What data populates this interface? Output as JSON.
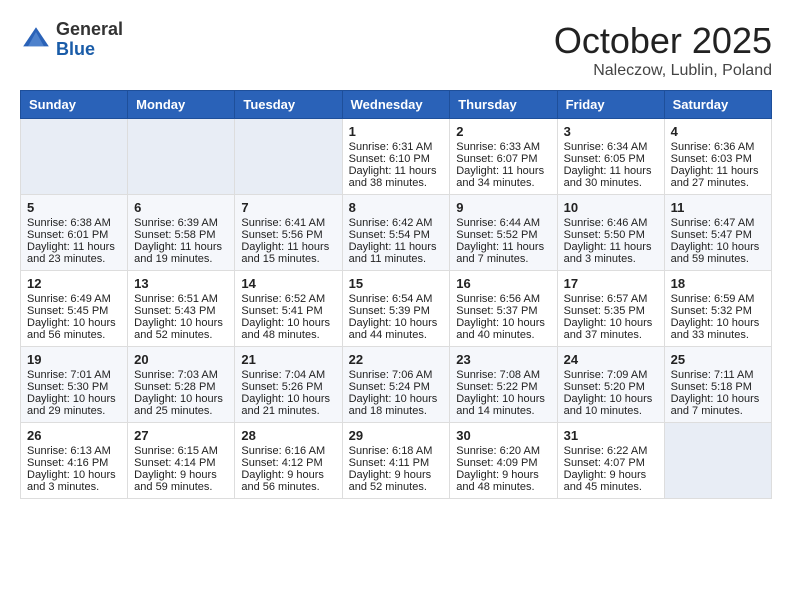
{
  "header": {
    "logo_general": "General",
    "logo_blue": "Blue",
    "month_title": "October 2025",
    "location": "Naleczow, Lublin, Poland"
  },
  "days_of_week": [
    "Sunday",
    "Monday",
    "Tuesday",
    "Wednesday",
    "Thursday",
    "Friday",
    "Saturday"
  ],
  "weeks": [
    [
      {
        "day": "",
        "info": ""
      },
      {
        "day": "",
        "info": ""
      },
      {
        "day": "",
        "info": ""
      },
      {
        "day": "1",
        "info": "Sunrise: 6:31 AM\nSunset: 6:10 PM\nDaylight: 11 hours\nand 38 minutes."
      },
      {
        "day": "2",
        "info": "Sunrise: 6:33 AM\nSunset: 6:07 PM\nDaylight: 11 hours\nand 34 minutes."
      },
      {
        "day": "3",
        "info": "Sunrise: 6:34 AM\nSunset: 6:05 PM\nDaylight: 11 hours\nand 30 minutes."
      },
      {
        "day": "4",
        "info": "Sunrise: 6:36 AM\nSunset: 6:03 PM\nDaylight: 11 hours\nand 27 minutes."
      }
    ],
    [
      {
        "day": "5",
        "info": "Sunrise: 6:38 AM\nSunset: 6:01 PM\nDaylight: 11 hours\nand 23 minutes."
      },
      {
        "day": "6",
        "info": "Sunrise: 6:39 AM\nSunset: 5:58 PM\nDaylight: 11 hours\nand 19 minutes."
      },
      {
        "day": "7",
        "info": "Sunrise: 6:41 AM\nSunset: 5:56 PM\nDaylight: 11 hours\nand 15 minutes."
      },
      {
        "day": "8",
        "info": "Sunrise: 6:42 AM\nSunset: 5:54 PM\nDaylight: 11 hours\nand 11 minutes."
      },
      {
        "day": "9",
        "info": "Sunrise: 6:44 AM\nSunset: 5:52 PM\nDaylight: 11 hours\nand 7 minutes."
      },
      {
        "day": "10",
        "info": "Sunrise: 6:46 AM\nSunset: 5:50 PM\nDaylight: 11 hours\nand 3 minutes."
      },
      {
        "day": "11",
        "info": "Sunrise: 6:47 AM\nSunset: 5:47 PM\nDaylight: 10 hours\nand 59 minutes."
      }
    ],
    [
      {
        "day": "12",
        "info": "Sunrise: 6:49 AM\nSunset: 5:45 PM\nDaylight: 10 hours\nand 56 minutes."
      },
      {
        "day": "13",
        "info": "Sunrise: 6:51 AM\nSunset: 5:43 PM\nDaylight: 10 hours\nand 52 minutes."
      },
      {
        "day": "14",
        "info": "Sunrise: 6:52 AM\nSunset: 5:41 PM\nDaylight: 10 hours\nand 48 minutes."
      },
      {
        "day": "15",
        "info": "Sunrise: 6:54 AM\nSunset: 5:39 PM\nDaylight: 10 hours\nand 44 minutes."
      },
      {
        "day": "16",
        "info": "Sunrise: 6:56 AM\nSunset: 5:37 PM\nDaylight: 10 hours\nand 40 minutes."
      },
      {
        "day": "17",
        "info": "Sunrise: 6:57 AM\nSunset: 5:35 PM\nDaylight: 10 hours\nand 37 minutes."
      },
      {
        "day": "18",
        "info": "Sunrise: 6:59 AM\nSunset: 5:32 PM\nDaylight: 10 hours\nand 33 minutes."
      }
    ],
    [
      {
        "day": "19",
        "info": "Sunrise: 7:01 AM\nSunset: 5:30 PM\nDaylight: 10 hours\nand 29 minutes."
      },
      {
        "day": "20",
        "info": "Sunrise: 7:03 AM\nSunset: 5:28 PM\nDaylight: 10 hours\nand 25 minutes."
      },
      {
        "day": "21",
        "info": "Sunrise: 7:04 AM\nSunset: 5:26 PM\nDaylight: 10 hours\nand 21 minutes."
      },
      {
        "day": "22",
        "info": "Sunrise: 7:06 AM\nSunset: 5:24 PM\nDaylight: 10 hours\nand 18 minutes."
      },
      {
        "day": "23",
        "info": "Sunrise: 7:08 AM\nSunset: 5:22 PM\nDaylight: 10 hours\nand 14 minutes."
      },
      {
        "day": "24",
        "info": "Sunrise: 7:09 AM\nSunset: 5:20 PM\nDaylight: 10 hours\nand 10 minutes."
      },
      {
        "day": "25",
        "info": "Sunrise: 7:11 AM\nSunset: 5:18 PM\nDaylight: 10 hours\nand 7 minutes."
      }
    ],
    [
      {
        "day": "26",
        "info": "Sunrise: 6:13 AM\nSunset: 4:16 PM\nDaylight: 10 hours\nand 3 minutes."
      },
      {
        "day": "27",
        "info": "Sunrise: 6:15 AM\nSunset: 4:14 PM\nDaylight: 9 hours\nand 59 minutes."
      },
      {
        "day": "28",
        "info": "Sunrise: 6:16 AM\nSunset: 4:12 PM\nDaylight: 9 hours\nand 56 minutes."
      },
      {
        "day": "29",
        "info": "Sunrise: 6:18 AM\nSunset: 4:11 PM\nDaylight: 9 hours\nand 52 minutes."
      },
      {
        "day": "30",
        "info": "Sunrise: 6:20 AM\nSunset: 4:09 PM\nDaylight: 9 hours\nand 48 minutes."
      },
      {
        "day": "31",
        "info": "Sunrise: 6:22 AM\nSunset: 4:07 PM\nDaylight: 9 hours\nand 45 minutes."
      },
      {
        "day": "",
        "info": ""
      }
    ]
  ]
}
